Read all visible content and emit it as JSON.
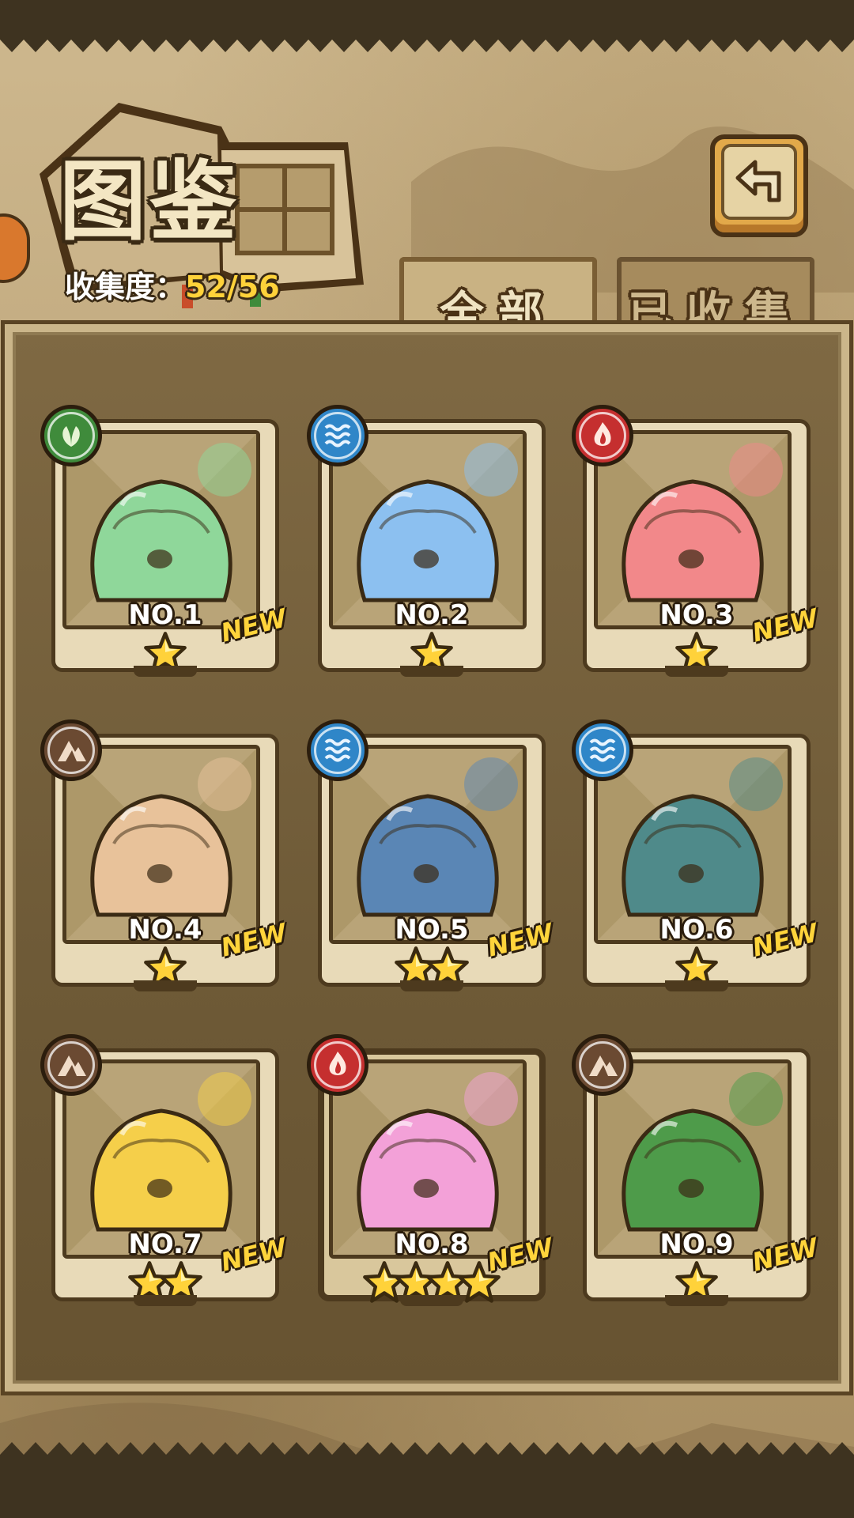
{
  "header": {
    "title": "图鉴",
    "collection_label": "收集度：",
    "collection_value": "52/56"
  },
  "tabs": [
    {
      "label": "全部",
      "active": true
    },
    {
      "label": "已收集",
      "active": false
    }
  ],
  "back_button": {
    "icon": "return-arrow-icon"
  },
  "cards": [
    {
      "number": "NO.1",
      "element": "grass",
      "stars": 1,
      "new": "NEW",
      "color": "#8fd79a"
    },
    {
      "number": "NO.2",
      "element": "water",
      "stars": 1,
      "new": "",
      "color": "#8cc0f0"
    },
    {
      "number": "NO.3",
      "element": "fire",
      "stars": 1,
      "new": "NEW",
      "color": "#f2888a"
    },
    {
      "number": "NO.4",
      "element": "earth",
      "stars": 1,
      "new": "NEW",
      "color": "#e8c29a"
    },
    {
      "number": "NO.5",
      "element": "water",
      "stars": 2,
      "new": "NEW",
      "color": "#5a86b5"
    },
    {
      "number": "NO.6",
      "element": "water",
      "stars": 1,
      "new": "NEW",
      "color": "#4f8a8a"
    },
    {
      "number": "NO.7",
      "element": "earth",
      "stars": 2,
      "new": "NEW",
      "color": "#f5cf4a"
    },
    {
      "number": "NO.8",
      "element": "fire",
      "stars": 4,
      "new": "NEW",
      "color": "#f3a1d8"
    },
    {
      "number": "NO.9",
      "element": "earth",
      "stars": 1,
      "new": "NEW",
      "color": "#4e9b4a"
    }
  ],
  "colors": {
    "accent_gold": "#ffd23a",
    "frame_dark": "#4d3a1e",
    "parchment": "#c9b283"
  }
}
